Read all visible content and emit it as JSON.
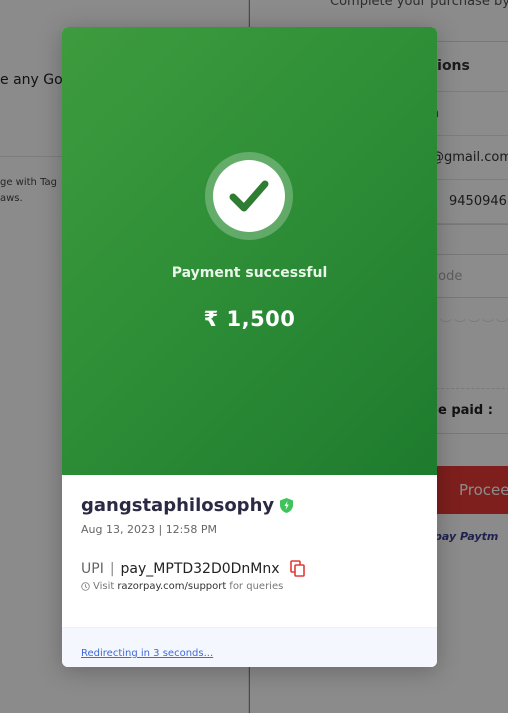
{
  "background": {
    "left": {
      "partial_text": "e any Go",
      "note_line1": "ge with Tag",
      "note_line2": "aws."
    },
    "right": {
      "subtitle": "Complete your purchase by",
      "card_header": "ations",
      "name_value": "a",
      "email_value": "@gmail.com",
      "phone_value": "9450946",
      "promo_placeholder": "code",
      "to_be_paid_label": "e paid :",
      "proceed_label": "Procee",
      "payment_logos": "pay  Paytm"
    }
  },
  "modal": {
    "status_text": "Payment successful",
    "amount": "₹ 1,500",
    "merchant_name": "gangstaphilosophy",
    "date": "Aug 13, 2023",
    "time": "12:58 PM",
    "date_separator": "|",
    "method_label": "UPI",
    "method_separator": "|",
    "payment_id": "pay_MPTD32D0DnMnx",
    "visit_prefix": "Visit",
    "support_link": "razorpay.com/support",
    "visit_suffix": "for queries",
    "redirect_text": "Redirecting in 3 seconds..."
  },
  "colors": {
    "success_green": "#2f8f37",
    "proceed_red": "#e53935",
    "link_blue": "#3f6ad8"
  },
  "icons": [
    "check-icon",
    "verified-shield-icon",
    "copy-icon",
    "info-icon"
  ]
}
